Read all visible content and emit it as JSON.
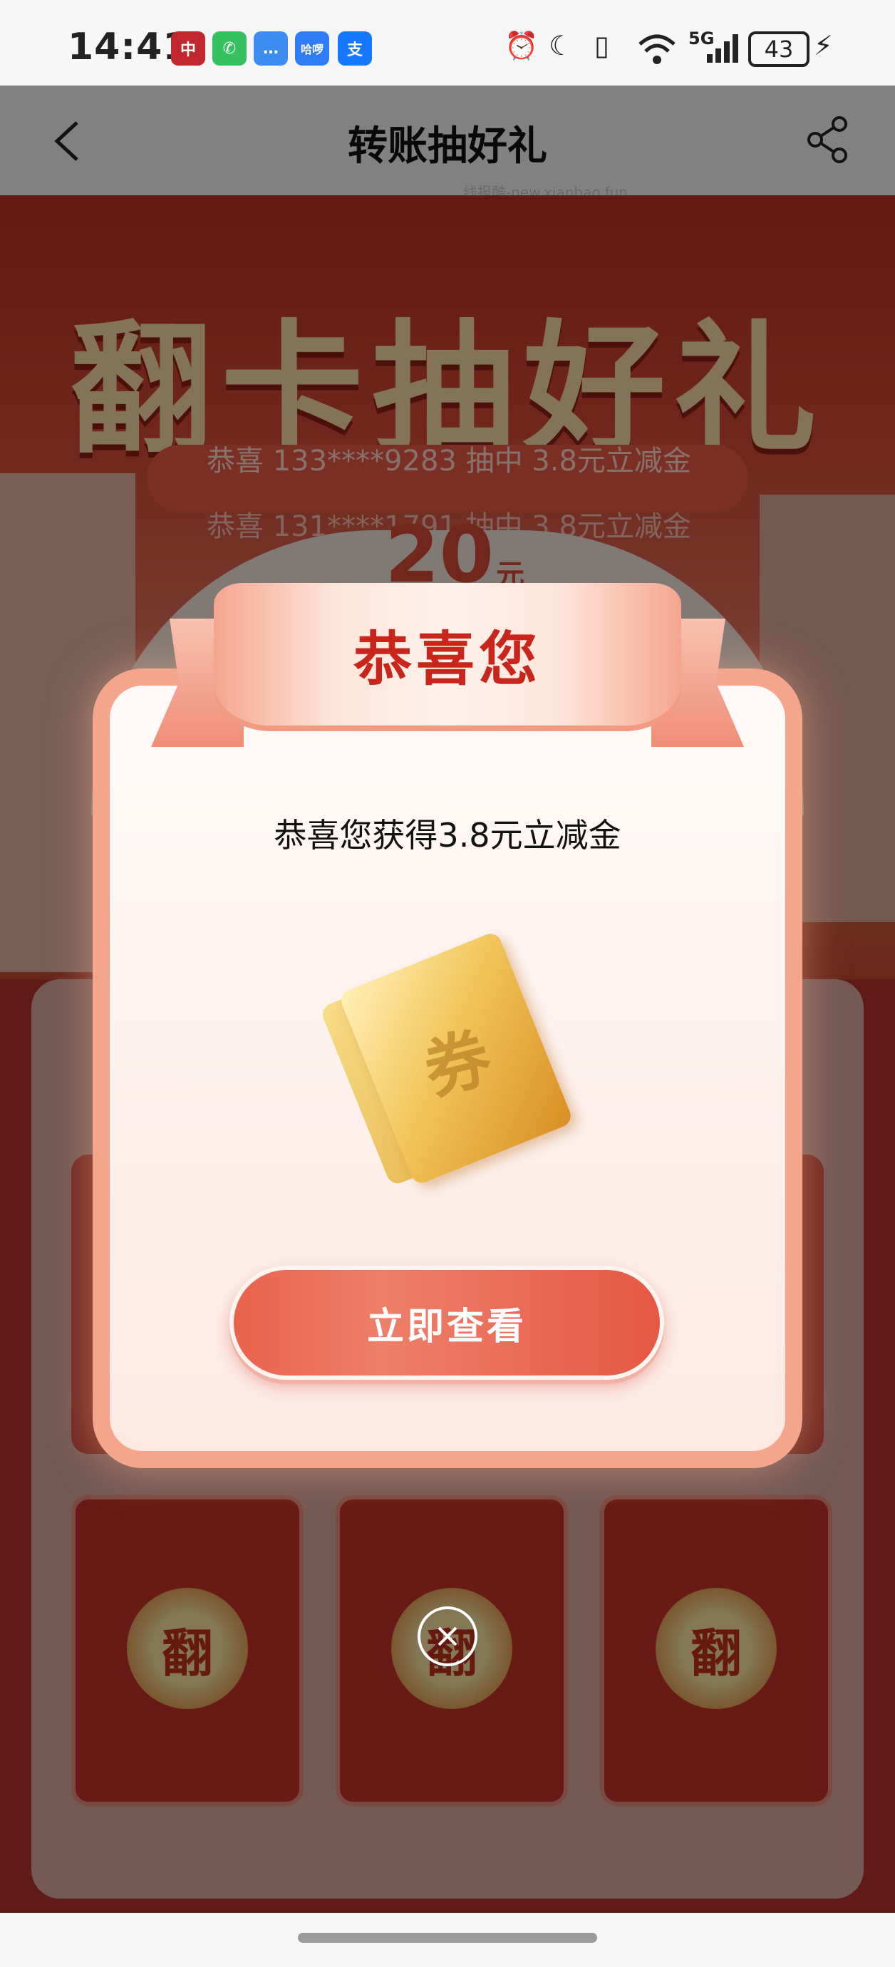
{
  "status_bar": {
    "time": "14:41",
    "apps": [
      {
        "name": "boc-icon",
        "glyph": "中",
        "color": "#c0282d"
      },
      {
        "name": "wechat-icon",
        "glyph": "✆",
        "color": "#36c160"
      },
      {
        "name": "message-icon",
        "glyph": "…",
        "color": "#3d8cf0"
      },
      {
        "name": "hello-icon",
        "glyph": "哈啰",
        "color": "#2f7cf6"
      },
      {
        "name": "alipay-icon",
        "glyph": "支",
        "color": "#1677ff"
      }
    ],
    "signal_label": "5G",
    "battery": "43"
  },
  "header": {
    "title": "转账抽好礼",
    "watermark": "线报酷-new.xianbao.fun"
  },
  "hero": {
    "title": "翻卡抽好礼",
    "ticker": [
      "恭喜 133****9283 抽中 3.8元立减金",
      "恭喜 131****1791 抽中 3.8元立减金"
    ],
    "prize_value": "20",
    "prize_unit": "元"
  },
  "cards": [
    {
      "label": "翻"
    },
    {
      "label": "翻"
    },
    {
      "label": "翻"
    }
  ],
  "modal": {
    "title": "恭喜您",
    "message": "恭喜您获得3.8元立减金",
    "coupon_label": "券",
    "button_label": "立即查看"
  },
  "colors": {
    "accent": "#c9251b",
    "button": "#e9624c",
    "modal_border": "#f4a58c",
    "coupon_gold": "#f2c55a"
  }
}
